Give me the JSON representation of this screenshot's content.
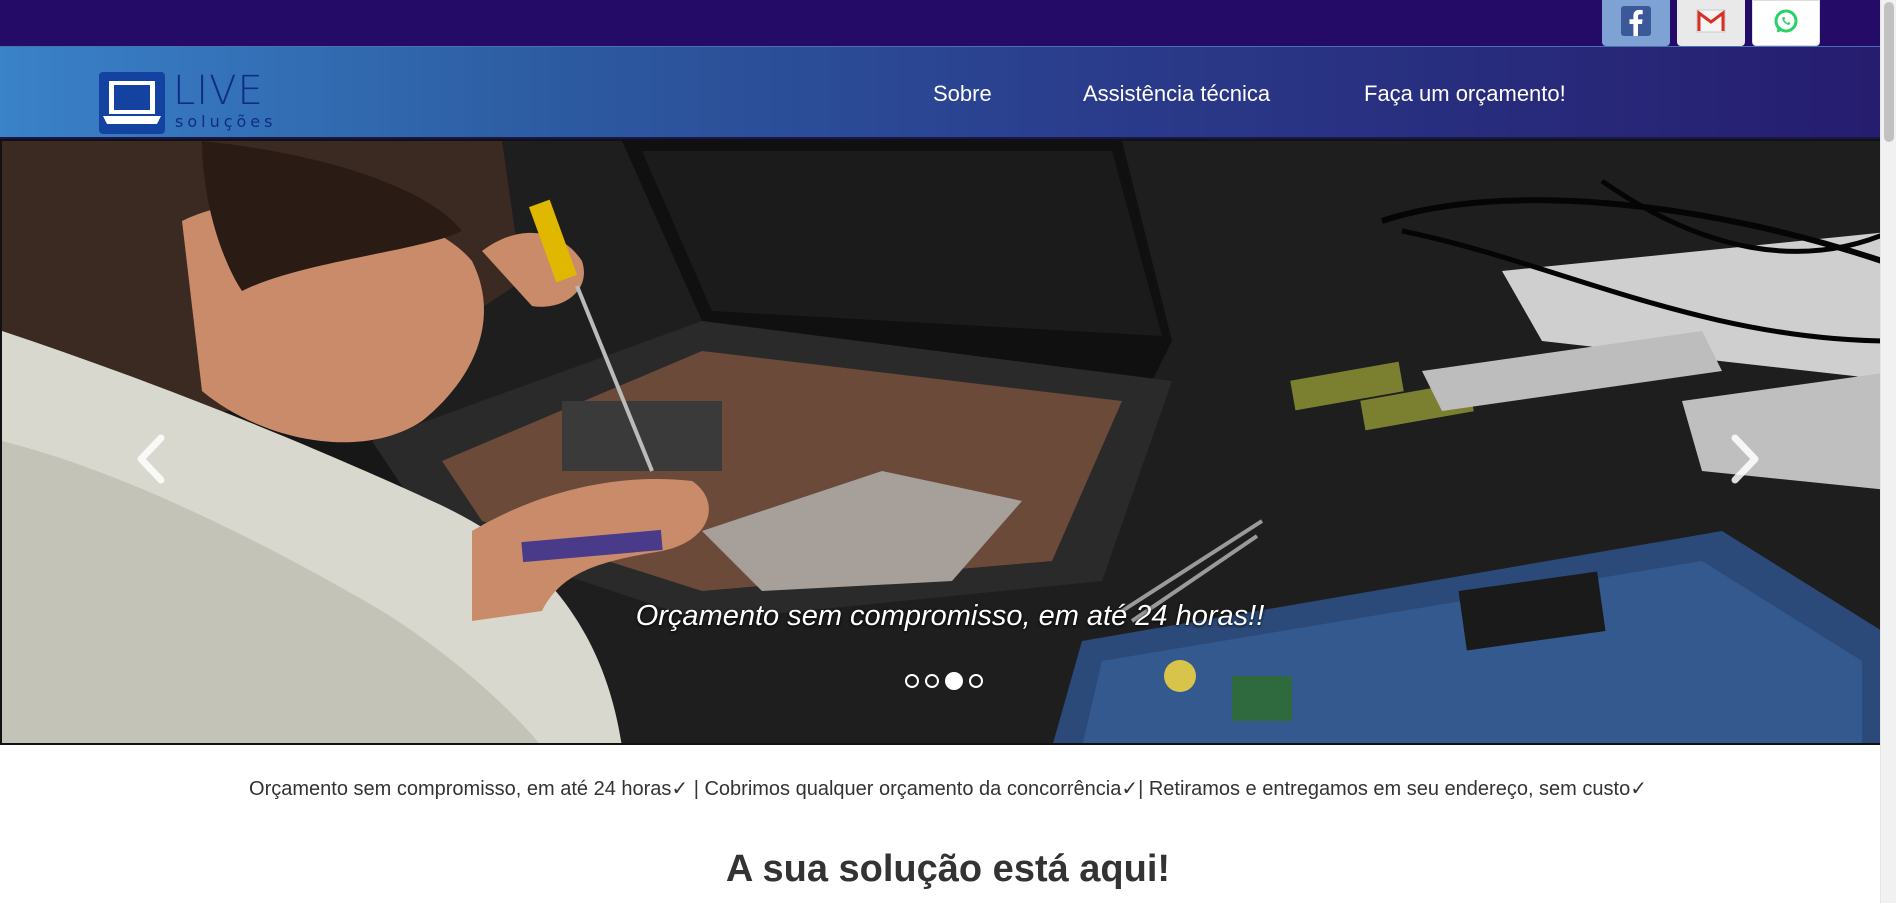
{
  "social": {
    "items": [
      {
        "name": "facebook",
        "icon": "facebook-icon",
        "color": "#3b5998"
      },
      {
        "name": "gmail",
        "icon": "gmail-icon",
        "color": "#d93025"
      },
      {
        "name": "whatsapp",
        "icon": "whatsapp-icon",
        "color": "#25d366"
      }
    ]
  },
  "brand": {
    "name": "LIVE",
    "tagline": "soluções"
  },
  "nav": {
    "items": [
      {
        "label": "Sobre"
      },
      {
        "label": "Assistência técnica"
      },
      {
        "label": "Faça um orçamento!"
      }
    ]
  },
  "carousel": {
    "caption": "Orçamento sem compromisso, em até 24 horas!!",
    "slide_count": 4,
    "active_index": 2,
    "prev_icon": "chevron-left-icon",
    "next_icon": "chevron-right-icon"
  },
  "benefits": "Orçamento sem compromisso, em até 24 horas✓ | Cobrimos qualquer orçamento da concorrência✓| Retiramos e entregamos em seu endereço, sem custo✓",
  "section": {
    "heading": "A sua solução está aqui!"
  },
  "colors": {
    "top_strip": "#240b68",
    "nav_gradient_start": "#3a82c9",
    "nav_gradient_end": "#261c6e",
    "brand": "#0e2d86"
  }
}
